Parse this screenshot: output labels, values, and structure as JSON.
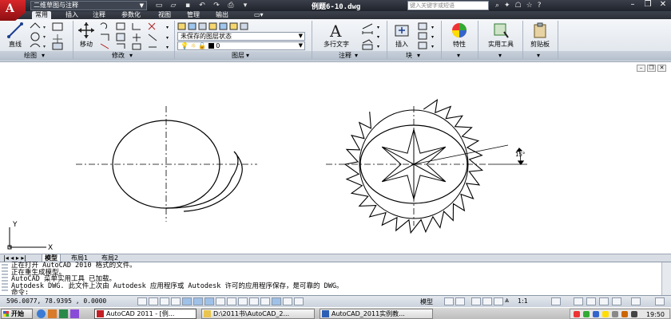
{
  "title_bar": {
    "workspace": "二维草图与注释",
    "document_title": "例题6-10.dwg",
    "search_placeholder": "键入关键字或短语"
  },
  "ribbon": {
    "tabs": [
      "常用",
      "插入",
      "注释",
      "参数化",
      "视图",
      "管理",
      "输出"
    ],
    "active_tab": "常用",
    "buttons": {
      "line": "直线",
      "move": "移动",
      "multiline_text": "多行文字",
      "insert": "插入",
      "properties": "特性",
      "utilities": "实用工具",
      "clipboard": "剪贴板"
    },
    "layer_state": "未保存的图层状态",
    "layer_name": "0",
    "panel_labels": [
      "绘图",
      "修改",
      "图层",
      "注释",
      "块"
    ]
  },
  "drawing": {
    "dimension_text": "15°",
    "ucs_x": "X",
    "ucs_y": "Y"
  },
  "layout_tabs": [
    "模型",
    "布局1",
    "布局2"
  ],
  "command_history": [
    "正在打开 AutoCAD 2010 格式的文件。",
    "正在重生成模型。",
    "AutoCAD 菜单实用工具 已加载。",
    "Autodesk DWG.   此文件上次由 Autodesk 应用程序或 Autodesk 许可的应用程序保存，是可靠的 DWG。",
    "命令:"
  ],
  "status_bar": {
    "coordinates": "596.0077, 78.9395 , 0.0000",
    "model_label": "模型",
    "annotation_scale": "1:1"
  },
  "taskbar": {
    "start_label": "开始",
    "tasks": [
      "AutoCAD 2011 - [例...",
      "D:\\2011书\\AutoCAD_2...",
      "AutoCAD_2011实例教..."
    ],
    "clock": "19:50"
  },
  "colors": {
    "title_bg": "#2a2e36",
    "ribbon_bg": "#eef1f5",
    "accent_red": "#c31f24",
    "drawing_bg": "#ffffff"
  }
}
